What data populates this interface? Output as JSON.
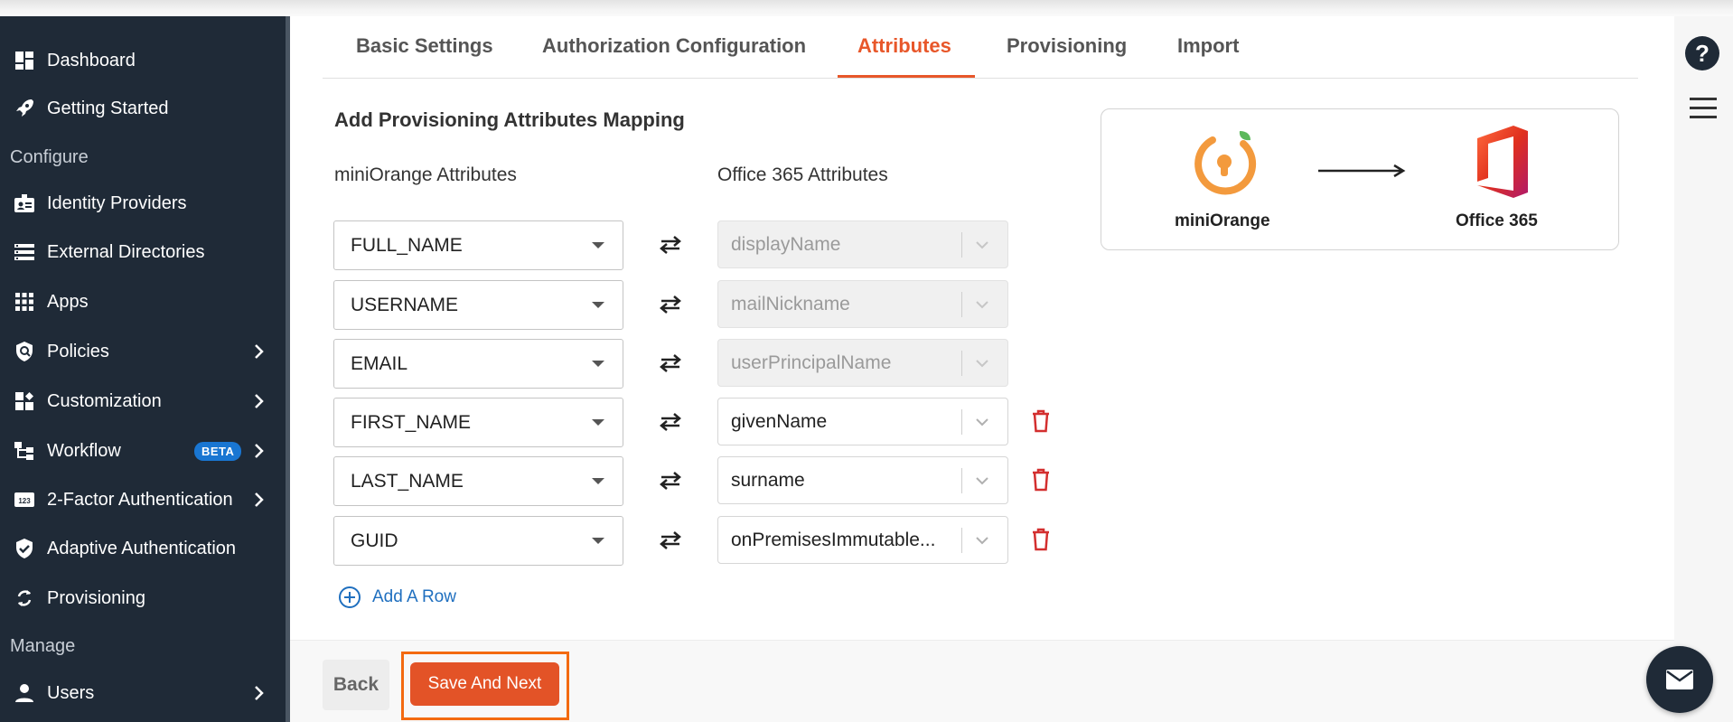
{
  "sidebar": {
    "items": [
      {
        "label": "Dashboard",
        "icon": "dashboard-icon"
      },
      {
        "label": "Getting Started",
        "icon": "rocket-icon"
      },
      {
        "label": "Identity Providers",
        "icon": "id-badge-icon"
      },
      {
        "label": "External Directories",
        "icon": "directory-list-icon"
      },
      {
        "label": "Apps",
        "icon": "apps-grid-icon"
      },
      {
        "label": "Policies",
        "icon": "shield-icon"
      },
      {
        "label": "Customization",
        "icon": "customization-icon"
      },
      {
        "label": "Workflow",
        "icon": "workflow-icon",
        "badge": "BETA"
      },
      {
        "label": "2-Factor Authentication",
        "icon": "2fa-123-icon"
      },
      {
        "label": "Adaptive Authentication",
        "icon": "shield-check-icon"
      },
      {
        "label": "Provisioning",
        "icon": "sync-icon"
      },
      {
        "label": "Users",
        "icon": "user-icon"
      }
    ],
    "sections": {
      "configure": "Configure",
      "manage": "Manage"
    }
  },
  "tabs": [
    {
      "label": "Basic Settings"
    },
    {
      "label": "Authorization Configuration"
    },
    {
      "label": "Attributes",
      "active": true
    },
    {
      "label": "Provisioning"
    },
    {
      "label": "Import"
    }
  ],
  "main": {
    "title": "Add Provisioning Attributes Mapping",
    "source_header": "miniOrange Attributes",
    "target_header": "Office 365 Attributes",
    "add_row_label": "Add A Row",
    "mappings": [
      {
        "source": "FULL_NAME",
        "target": "displayName",
        "disabled": true
      },
      {
        "source": "USERNAME",
        "target": "mailNickname",
        "disabled": true
      },
      {
        "source": "EMAIL",
        "target": "userPrincipalName",
        "disabled": true
      },
      {
        "source": "FIRST_NAME",
        "target": "givenName",
        "disabled": false
      },
      {
        "source": "LAST_NAME",
        "target": "surname",
        "disabled": false
      },
      {
        "source": "GUID",
        "target": "onPremisesImmutable...",
        "disabled": false
      }
    ]
  },
  "card": {
    "source_name": "miniOrange",
    "target_name": "Office 365"
  },
  "footer": {
    "back_label": "Back",
    "save_label": "Save And Next"
  },
  "colors": {
    "accent": "#e8572a",
    "sidebar": "#1f2a37",
    "link": "#1f6fbf",
    "delete": "#d32f2f"
  }
}
